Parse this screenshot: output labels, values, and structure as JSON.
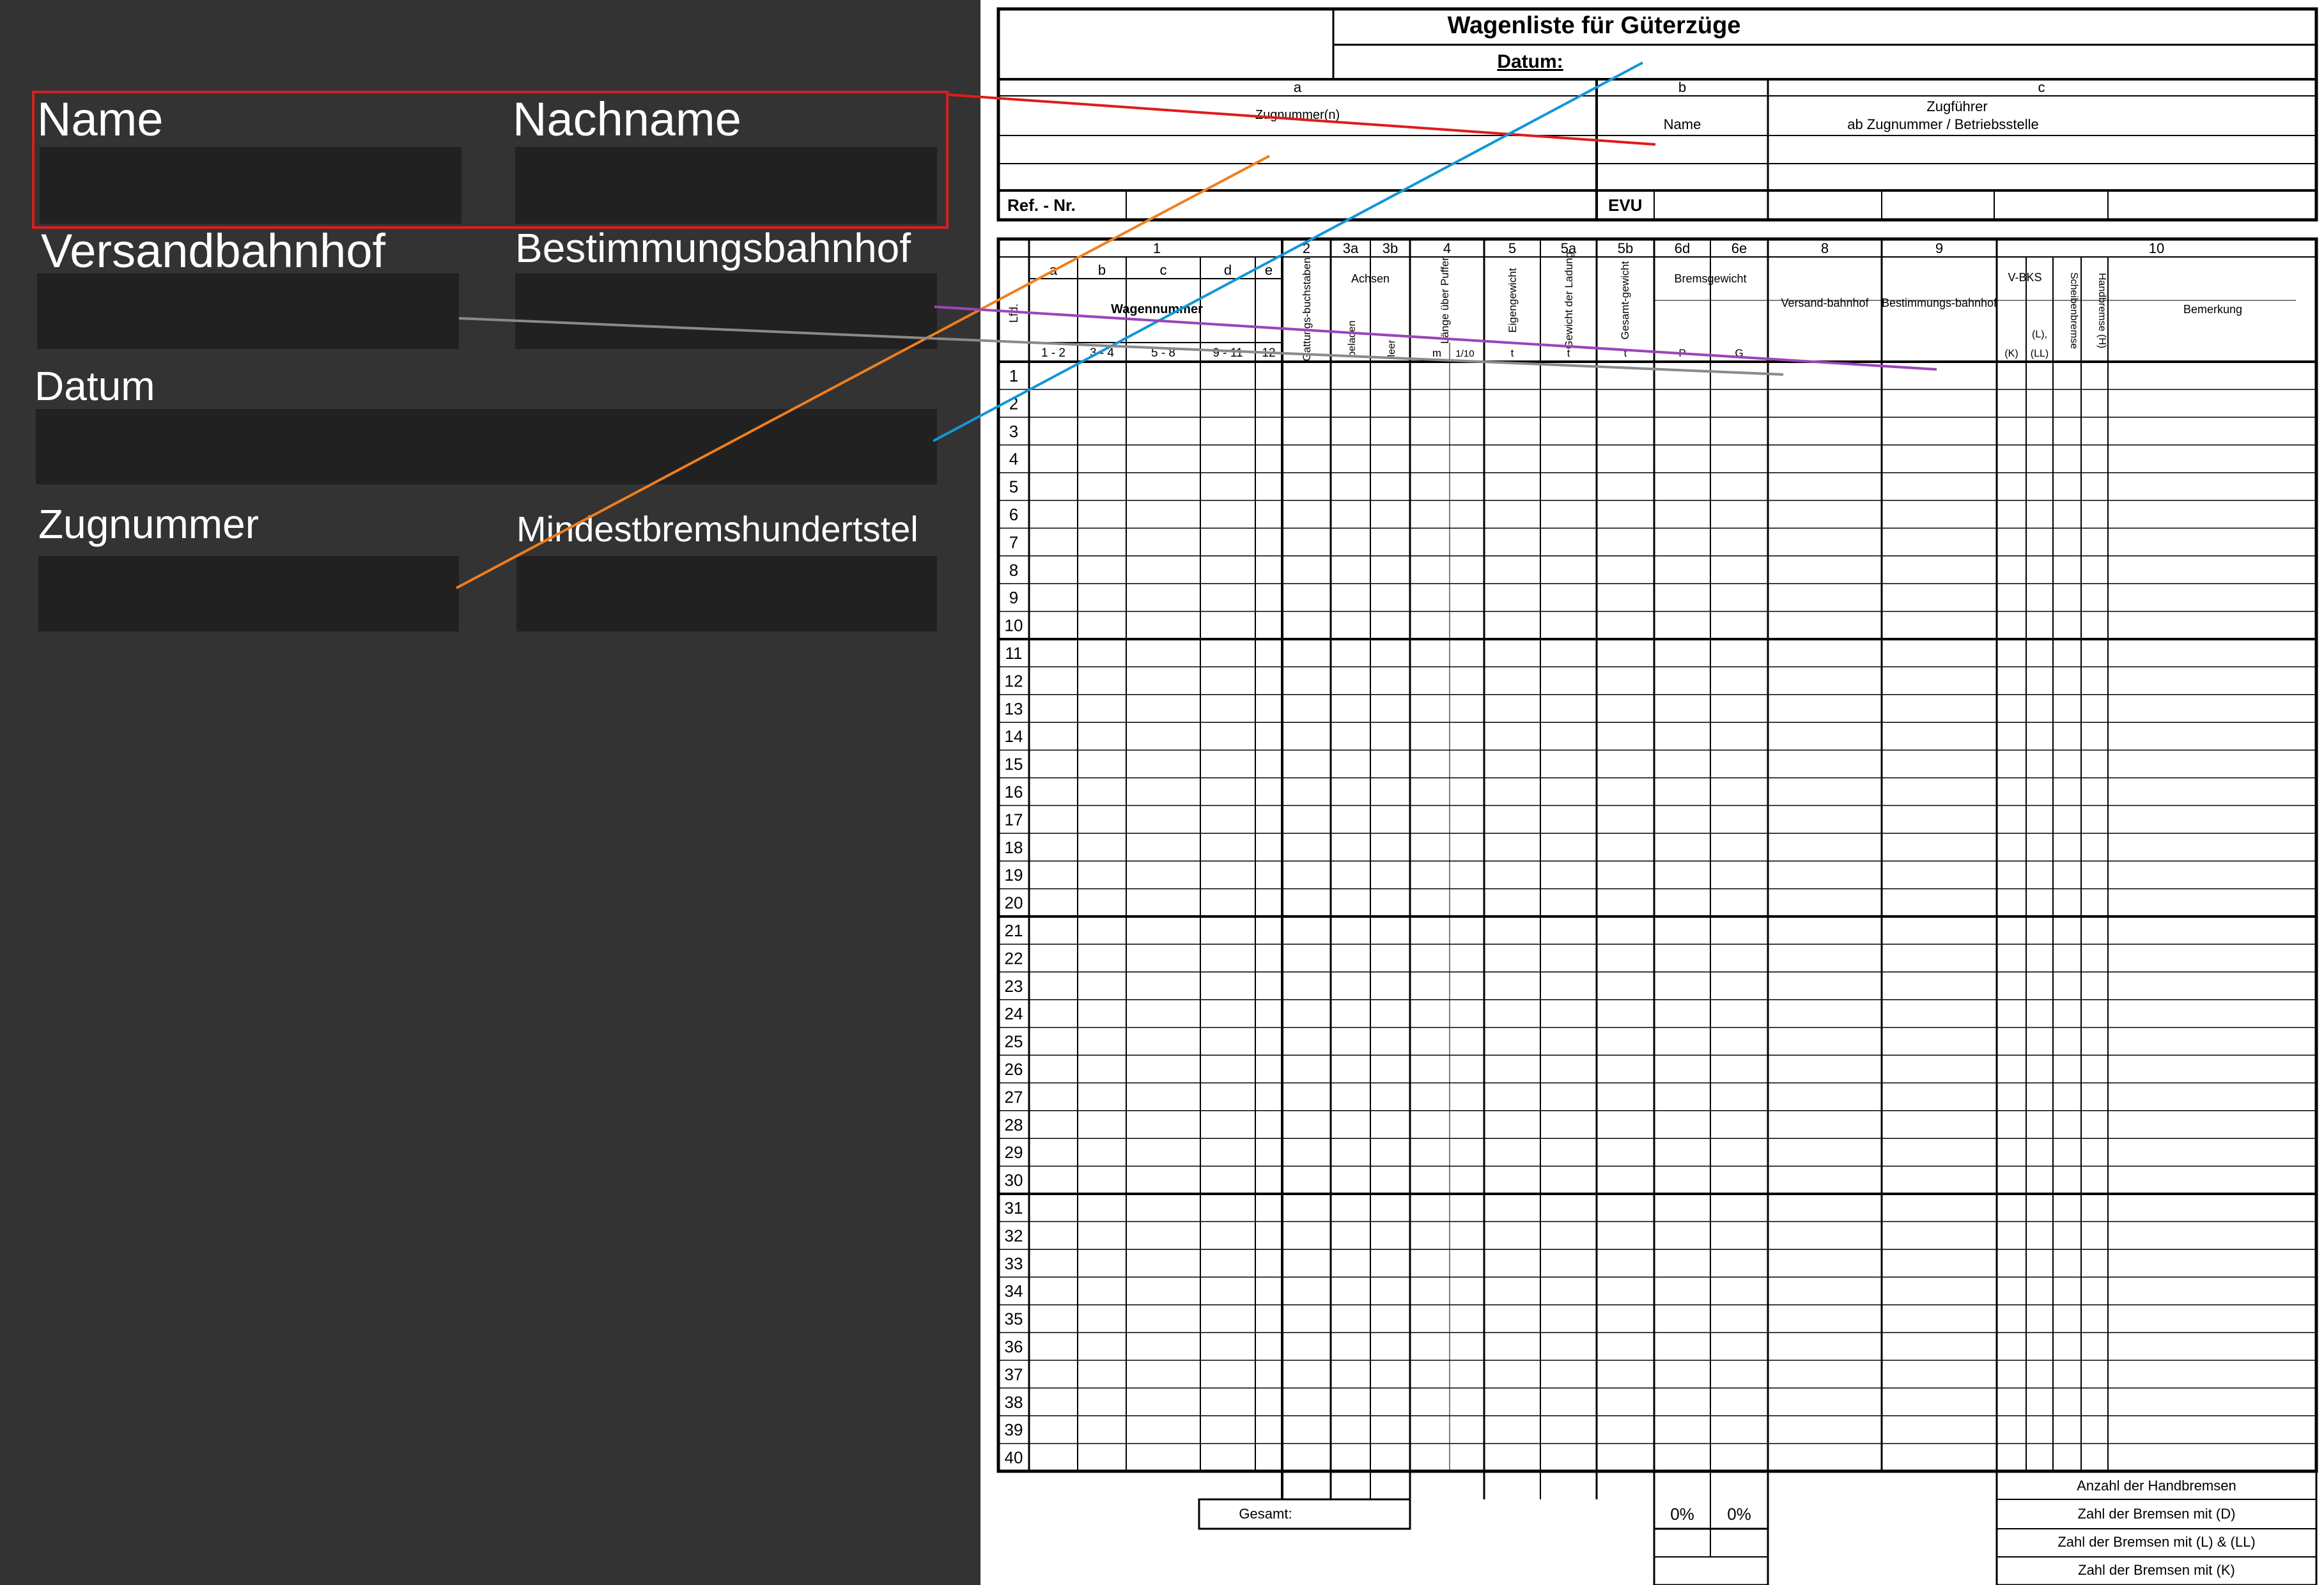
{
  "colors": {
    "panel": "#333333",
    "field": "#212121",
    "selection": "#d42020",
    "link_zugfuehrer": "#e01b1b",
    "link_datum": "#1396d8",
    "link_zugnummer": "#f07f1e",
    "link_versand": "#8a8a8a",
    "link_bestimmung": "#9a45b8"
  },
  "form": {
    "name": {
      "label": "Name",
      "value": ""
    },
    "nachname": {
      "label": "Nachname",
      "value": ""
    },
    "versandbahnhof": {
      "label": "Versandbahnhof",
      "value": ""
    },
    "bestimmungsbahnhof": {
      "label": "Bestimmungsbahnhof",
      "value": ""
    },
    "datum": {
      "label": "Datum",
      "value": ""
    },
    "zugnummer": {
      "label": "Zugnummer",
      "value": ""
    },
    "mindestbremshundertstel": {
      "label": "Mindestbremshundertstel",
      "value": ""
    }
  },
  "sheet": {
    "title": "Wagenliste für Güterzüge",
    "datum_label": "Datum:",
    "head": {
      "a": "a",
      "b": "b",
      "c": "c",
      "zugnummern": "Zugnummer(n)",
      "zugfuehrer": "Zugführer",
      "name": "Name",
      "ab_zugnummer": "ab Zugnummer / Betriebsstelle",
      "ref_nr": "Ref. - Nr.",
      "evu": "EVU"
    },
    "col_numbers": {
      "c1": "1",
      "c2": "2",
      "c3a": "3a",
      "c3b": "3b",
      "c4": "4",
      "c5": "5",
      "c5a": "5a",
      "c5b": "5b",
      "c6d": "6d",
      "c6e": "6e",
      "c8": "8",
      "c9": "9",
      "c10": "10"
    },
    "sub_letters": {
      "a": "a",
      "b": "b",
      "c": "c",
      "d": "d",
      "e": "e"
    },
    "headers": {
      "lfd": "Lfd.",
      "wagennummer": "Wagennummer",
      "gattung": "Gattungs-buchstaben",
      "achsen": "Achsen",
      "beladen": "beladen",
      "leer": "leer",
      "laenge": "Länge über Puffer",
      "eigengewicht": "Eigengewicht",
      "gewicht_ladung": "Gewicht der Ladung",
      "gesamtgewicht": "Gesamt-gewicht",
      "bremsgewicht": "Bremsgewicht",
      "versand": "Versand-bahnhof",
      "bestimmung": "Bestimmungs-bahnhof",
      "vbks": "V-BKS",
      "scheibenbremse": "Scheibenbremse",
      "handbremse": "Handbremse (H)",
      "bemerkung": "Bemerkung"
    },
    "units": {
      "u12": "1 - 2",
      "u34": "3 - 4",
      "u58": "5 - 8",
      "u911": "9 - 11",
      "u12b": "12",
      "m": "m",
      "tenth": "1/10",
      "t1": "t",
      "t2": "t",
      "t3": "t",
      "p": "P",
      "g": "G",
      "k": "(K)",
      "l": "(L),",
      "ll": "(LL)"
    },
    "rows": [
      "1",
      "2",
      "3",
      "4",
      "5",
      "6",
      "7",
      "8",
      "9",
      "10",
      "11",
      "12",
      "13",
      "14",
      "15",
      "16",
      "17",
      "18",
      "19",
      "20",
      "21",
      "22",
      "23",
      "24",
      "25",
      "26",
      "27",
      "28",
      "29",
      "30",
      "31",
      "32",
      "33",
      "34",
      "35",
      "36",
      "37",
      "38",
      "39",
      "40"
    ],
    "footer": {
      "gesamt": "Gesamt:",
      "pct_p": "0%",
      "pct_g": "0%",
      "anzahl_handbremsen": "Anzahl der Handbremsen",
      "bremsen_d": "Zahl der Bremsen mit (D)",
      "bremsen_l_ll": "Zahl der Bremsen mit (L) & (LL)",
      "bremsen_k": "Zahl der Bremsen mit (K)"
    }
  }
}
